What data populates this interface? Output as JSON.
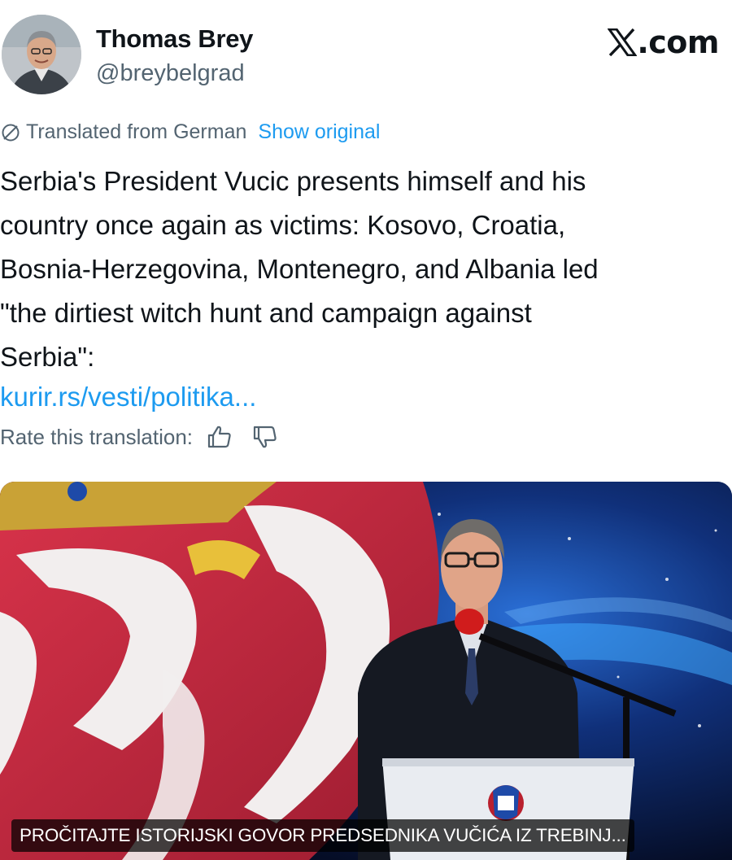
{
  "author": {
    "name": "Thomas Brey",
    "handle": "@breybelgrad"
  },
  "brand": {
    "logo_text": ".com",
    "icon": "x-logo-icon"
  },
  "translation": {
    "icon": "globe-icon",
    "notice": "Translated from German",
    "show_original": "Show original"
  },
  "tweet": {
    "text": "Serbia's President Vucic presents himself and his\ncountry once again as victims: Kosovo, Croatia,\nBosnia-Herzegovina, Montenegro, and Albania led\n\"the dirtiest witch hunt and campaign against\nSerbia\":",
    "link": "kurir.rs/vesti/politika..."
  },
  "rating": {
    "label": "Rate this translation:",
    "up_icon": "thumbs-up-icon",
    "down_icon": "thumbs-down-icon"
  },
  "media": {
    "caption": "PROČITAJTE ISTORIJSKI GOVOR PREDSEDNIKA VUČIĆA IZ TREBINJ..."
  },
  "colors": {
    "text": "#0f1419",
    "muted": "#536471",
    "link": "#1d9bf0"
  }
}
